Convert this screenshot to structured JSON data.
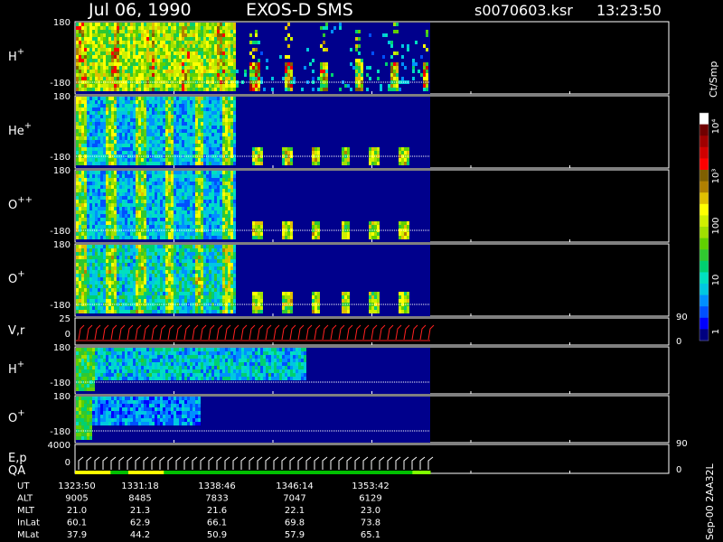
{
  "header": {
    "date": "Jul 06, 1990",
    "instrument": "EXOS-D SMS",
    "file": "s0070603.ksr",
    "time": "13:23:50"
  },
  "chart_data": {
    "type": "heatmap",
    "panels": [
      {
        "id": "h1",
        "label": "H",
        "sup": "+",
        "y_top": "180",
        "y_bottom": "-180",
        "kind": "spectrogram",
        "pattern": 0
      },
      {
        "id": "he",
        "label": "He",
        "sup": "+",
        "y_top": "180",
        "y_bottom": "-180",
        "kind": "spectrogram",
        "pattern": 1
      },
      {
        "id": "o2",
        "label": "O",
        "sup": "++",
        "y_top": "180",
        "y_bottom": "-180",
        "kind": "spectrogram",
        "pattern": 1
      },
      {
        "id": "o1",
        "label": "O",
        "sup": "+",
        "y_top": "180",
        "y_bottom": "-180",
        "kind": "spectrogram",
        "pattern": 2
      },
      {
        "id": "vr",
        "label": "V,r",
        "sup": "",
        "y_top": "25",
        "y_bottom": "0",
        "right_top": "90",
        "right_bottom": "0",
        "kind": "line"
      },
      {
        "id": "h2",
        "label": "H",
        "sup": "+",
        "y_top": "180",
        "y_bottom": "-180",
        "kind": "spectrogram",
        "pattern": 3
      },
      {
        "id": "o3",
        "label": "O",
        "sup": "+",
        "y_top": "180",
        "y_bottom": "-180",
        "kind": "spectrogram",
        "pattern": 4
      },
      {
        "id": "ep",
        "label": "E,p",
        "label2": "QA",
        "sup": "",
        "y_top": "4000",
        "y_bottom": "0",
        "right_top": "90",
        "right_bottom": "0",
        "kind": "line"
      }
    ],
    "colorbar": {
      "unit": "Ct/Smp",
      "tick_labels": [
        "10⁴",
        "10³",
        "100",
        "10",
        "1"
      ],
      "colors": [
        "#000080",
        "#0000ff",
        "#0050ff",
        "#0090ff",
        "#00c8e0",
        "#00e0c0",
        "#00d070",
        "#30c830",
        "#60d000",
        "#a0e000",
        "#d0f000",
        "#ffff00",
        "#e0c000",
        "#b08000",
        "#806000",
        "#ff0000",
        "#d00000",
        "#a00000",
        "#700000",
        "#ffffff"
      ]
    },
    "qa_bar": [
      "#ffff00",
      "#ffff00",
      "#00c000",
      "#ffff00",
      "#ffff00",
      "#00c000",
      "#00c000",
      "#00c000",
      "#00c000",
      "#00c000",
      "#00c000",
      "#00c000",
      "#00c000",
      "#00c000",
      "#00c000",
      "#00c000",
      "#00c000",
      "#00c000",
      "#00c000",
      "#80ff00"
    ],
    "footer": {
      "rows": [
        {
          "name": "UT",
          "values": [
            "1323:50",
            "1331:18",
            "1338:46",
            "1346:14",
            "1353:42"
          ]
        },
        {
          "name": "ALT",
          "values": [
            "9005",
            "8485",
            "7833",
            "7047",
            "6129"
          ]
        },
        {
          "name": "MLT",
          "values": [
            "21.0",
            "21.3",
            "21.6",
            "22.1",
            "23.0"
          ]
        },
        {
          "name": "InLat",
          "values": [
            "60.1",
            "62.9",
            "66.1",
            "69.8",
            "73.8"
          ]
        },
        {
          "name": "MLat",
          "values": [
            "37.9",
            "44.2",
            "50.9",
            "57.9",
            "65.1"
          ]
        }
      ]
    },
    "stamp": "Sep-00 2AA32L"
  }
}
